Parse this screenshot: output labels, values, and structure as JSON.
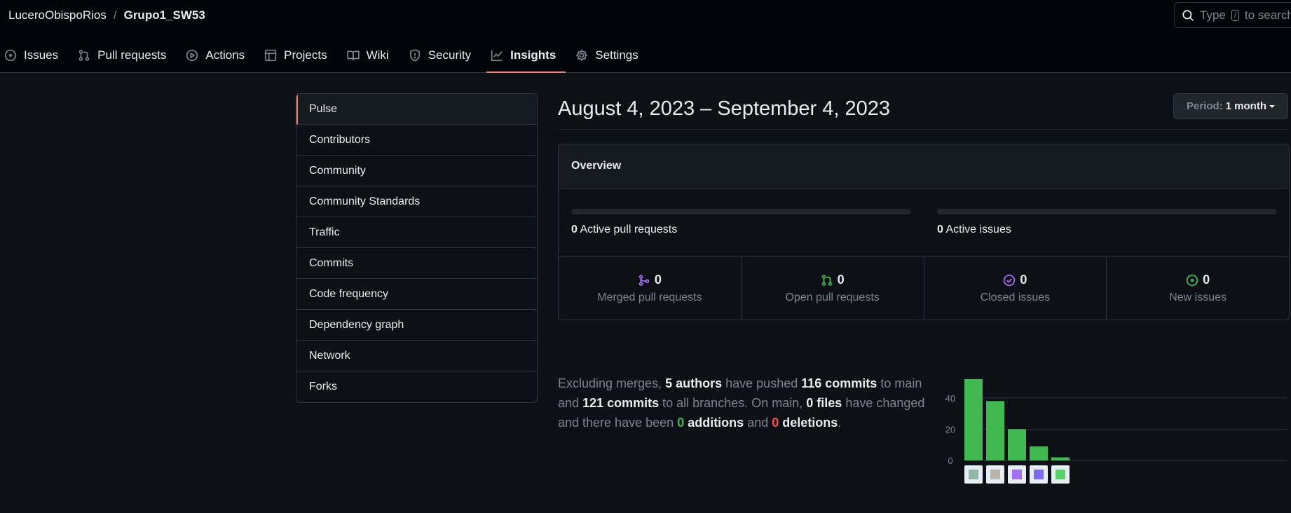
{
  "header": {
    "owner": "LuceroObispoRios",
    "separator": "/",
    "repo": "Grupo1_SW53",
    "search_prefix": "Type",
    "search_key": "/",
    "search_suffix": "to search"
  },
  "tabs": [
    {
      "label": "Issues",
      "icon": "issue-opened-icon"
    },
    {
      "label": "Pull requests",
      "icon": "git-pull-request-icon"
    },
    {
      "label": "Actions",
      "icon": "play-icon"
    },
    {
      "label": "Projects",
      "icon": "table-icon"
    },
    {
      "label": "Wiki",
      "icon": "book-icon"
    },
    {
      "label": "Security",
      "icon": "shield-icon"
    },
    {
      "label": "Insights",
      "icon": "graph-icon",
      "active": true
    },
    {
      "label": "Settings",
      "icon": "gear-icon"
    }
  ],
  "sidenav": [
    "Pulse",
    "Contributors",
    "Community",
    "Community Standards",
    "Traffic",
    "Commits",
    "Code frequency",
    "Dependency graph",
    "Network",
    "Forks"
  ],
  "period": {
    "title": "August 4, 2023 – September 4, 2023",
    "button_prefix": "Period:",
    "button_value": "1 month"
  },
  "overview": {
    "heading": "Overview",
    "active_prs_count": "0",
    "active_prs_label": "Active pull requests",
    "active_issues_count": "0",
    "active_issues_label": "Active issues",
    "merged_count": "0",
    "merged_label": "Merged pull requests",
    "open_count": "0",
    "open_label": "Open pull requests",
    "closed_count": "0",
    "closed_label": "Closed issues",
    "new_count": "0",
    "new_label": "New issues"
  },
  "summary": {
    "t1": "Excluding merges,",
    "authors": "5 authors",
    "t2": "have pushed",
    "commits_main": "116 commits",
    "t3": "to main and",
    "commits_all": "121 commits",
    "t4": "to all branches. On main,",
    "files": "0 files",
    "t5": "have changed and there have been",
    "additions_num": "0",
    "additions_word": "additions",
    "t6": "and",
    "deletions_num": "0",
    "deletions_word": "deletions",
    "t7": "."
  },
  "colors": {
    "accent": "#f78166",
    "green": "#3fb950",
    "red": "#f85149",
    "purple": "#a371f7"
  },
  "chart_data": {
    "type": "bar",
    "categories": [
      "author-1",
      "author-2",
      "author-3",
      "author-4",
      "author-5"
    ],
    "values": [
      52,
      38,
      20,
      9,
      2
    ],
    "ylim": [
      0,
      52
    ],
    "yticks": [
      0,
      20,
      40
    ],
    "grid": true
  }
}
